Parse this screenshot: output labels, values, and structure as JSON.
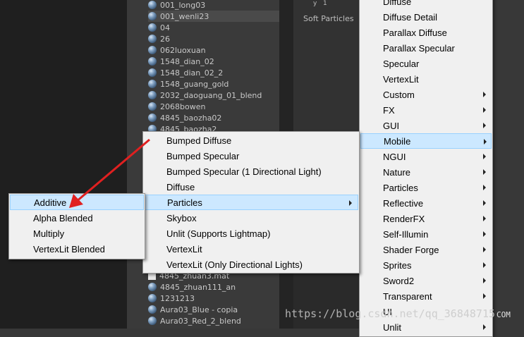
{
  "project_list": {
    "items": [
      {
        "label": "001_long03",
        "icon": "sphere"
      },
      {
        "label": "001_wenli23",
        "icon": "sphere",
        "selected": true
      },
      {
        "label": "04",
        "icon": "sphere"
      },
      {
        "label": "26",
        "icon": "sphere"
      },
      {
        "label": "062luoxuan",
        "icon": "sphere"
      },
      {
        "label": "1548_dian_02",
        "icon": "sphere"
      },
      {
        "label": "1548_dian_02_2",
        "icon": "sphere"
      },
      {
        "label": "1548_guang_gold",
        "icon": "sphere"
      },
      {
        "label": "2032_daoguang_01_blend",
        "icon": "sphere"
      },
      {
        "label": "2068bowen",
        "icon": "sphere"
      },
      {
        "label": "4845_baozha02",
        "icon": "sphere"
      },
      {
        "label": "4845_baozha2",
        "icon": "sphere"
      },
      {
        "label": "4845_zhuan3.mat",
        "icon": "file"
      },
      {
        "label": "4845_zhuan111_an",
        "icon": "sphere"
      },
      {
        "label": "1231213",
        "icon": "sphere"
      },
      {
        "label": "Aura03_Blue - copia",
        "icon": "sphere"
      },
      {
        "label": "Aura03_Red_2_blend",
        "icon": "sphere"
      }
    ]
  },
  "inspector": {
    "y_label": "y",
    "y_value": "1",
    "shader_label": "Soft Particles"
  },
  "shader_menu": {
    "items": [
      {
        "label": "Diffuse",
        "submenu": false
      },
      {
        "label": "Diffuse Detail",
        "submenu": false
      },
      {
        "label": "Parallax Diffuse",
        "submenu": false
      },
      {
        "label": "Parallax Specular",
        "submenu": false
      },
      {
        "label": "Specular",
        "submenu": false
      },
      {
        "label": "VertexLit",
        "submenu": false
      },
      {
        "label": "Custom",
        "submenu": true
      },
      {
        "label": "FX",
        "submenu": true
      },
      {
        "label": "GUI",
        "submenu": true
      },
      {
        "label": "Mobile",
        "submenu": true,
        "highlighted": true
      },
      {
        "label": "NGUI",
        "submenu": true
      },
      {
        "label": "Nature",
        "submenu": true
      },
      {
        "label": "Particles",
        "submenu": true
      },
      {
        "label": "Reflective",
        "submenu": true
      },
      {
        "label": "RenderFX",
        "submenu": true
      },
      {
        "label": "Self-Illumin",
        "submenu": true
      },
      {
        "label": "Shader Forge",
        "submenu": true
      },
      {
        "label": "Sprites",
        "submenu": true
      },
      {
        "label": "Sword2",
        "submenu": true
      },
      {
        "label": "Transparent",
        "submenu": true
      },
      {
        "label": "UI",
        "submenu": false
      },
      {
        "label": "Unlit",
        "submenu": true
      }
    ]
  },
  "mobile_menu": {
    "items": [
      {
        "label": "Bumped Diffuse",
        "submenu": false
      },
      {
        "label": "Bumped Specular",
        "submenu": false
      },
      {
        "label": "Bumped Specular (1 Directional Light)",
        "submenu": false
      },
      {
        "label": "Diffuse",
        "submenu": false
      },
      {
        "label": "Particles",
        "submenu": true,
        "highlighted": true
      },
      {
        "label": "Skybox",
        "submenu": false
      },
      {
        "label": "Unlit (Supports Lightmap)",
        "submenu": false
      },
      {
        "label": "VertexLit",
        "submenu": false
      },
      {
        "label": "VertexLit (Only Directional Lights)",
        "submenu": false
      }
    ]
  },
  "particles_menu": {
    "items": [
      {
        "label": "Additive",
        "highlighted": true
      },
      {
        "label": "Alpha Blended"
      },
      {
        "label": "Multiply"
      },
      {
        "label": "VertexLit Blended"
      }
    ]
  },
  "annotation": {
    "arrow_color": "#e02020"
  },
  "watermark": "https://blog.csdn.net/qq_36848715",
  "watermark_suffix": "COM"
}
